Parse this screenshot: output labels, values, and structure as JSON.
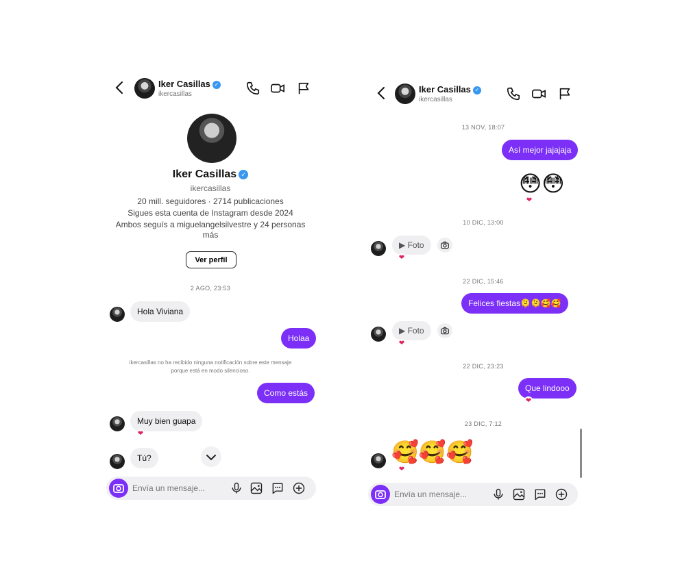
{
  "contact": {
    "name": "Iker Casillas",
    "username": "ikercasillas",
    "verified_glyph": "✓"
  },
  "profile": {
    "name": "Iker Casillas",
    "username": "ikercasillas",
    "stats": "20 mill. seguidores · 2714 publicaciones",
    "following_since": "Sigues esta cuenta de Instagram desde 2024",
    "mutual": "Ambos seguís a miguelangelsilvestre y 24 personas más",
    "view_profile_label": "Ver perfil"
  },
  "left_chat": {
    "timestamp_1": "2 AGO, 23:53",
    "msg_in_1": "Hola Viviana",
    "msg_out_1": "Holaa",
    "silent_note": "ikercasillas no ha recibido ninguna notificación sobre este mensaje porque está en modo silencioso.",
    "msg_out_2": "Como estás",
    "msg_in_2": "Muy bien guapa",
    "msg_in_3": "Tú?"
  },
  "right_chat": {
    "timestamp_1": "13 NOV, 18:07",
    "msg_out_1": "Así mejor jajajaja",
    "emoji_out_1": "😳😳",
    "timestamp_2": "10 DIC, 13:00",
    "foto_1": "▶ Foto",
    "timestamp_3": "22 DIC, 15:46",
    "msg_out_2": "Felices fiestas🫠🫠🥰🥰",
    "foto_2": "▶ Foto",
    "timestamp_4": "22 DIC, 23:23",
    "msg_out_3": "Que lindooo",
    "timestamp_5": "23 DIC, 7:12",
    "emoji_in_1": "🥰🥰🥰"
  },
  "composer": {
    "placeholder": "Envía un mensaje..."
  },
  "reaction": "❤",
  "colors": {
    "accent": "#7b2ff7",
    "verified": "#3897f0",
    "heart": "#e0245e",
    "bubble_in": "#efeff1"
  },
  "icons": [
    "back-arrow-icon",
    "phone-icon",
    "video-icon",
    "flag-icon",
    "camera-icon",
    "microphone-icon",
    "gallery-icon",
    "sticker-icon",
    "plus-icon",
    "chevron-down-icon",
    "play-icon"
  ]
}
